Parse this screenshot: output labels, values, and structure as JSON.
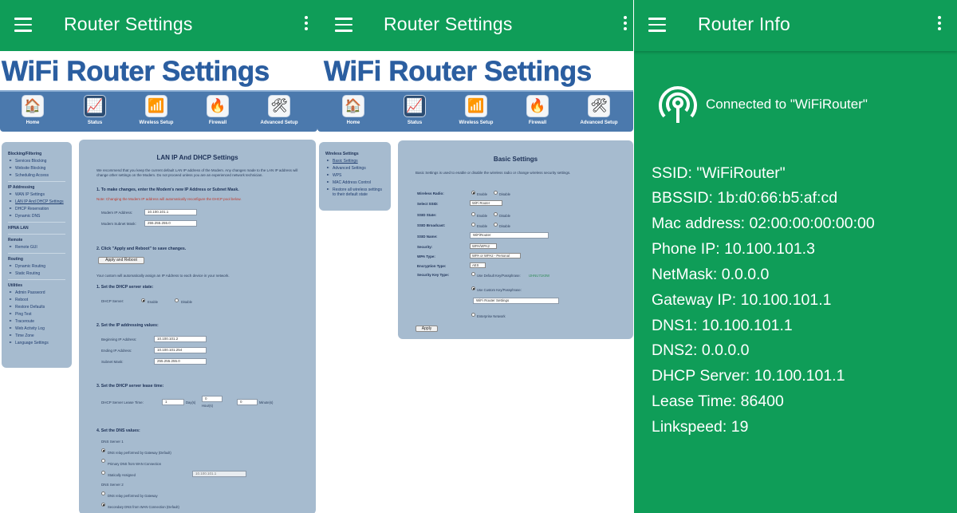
{
  "screen1": {
    "appbar_title": "Router Settings",
    "page_heading": "WiFi Router Settings",
    "nav": [
      {
        "label": "Home",
        "icon": "home-icon"
      },
      {
        "label": "Status",
        "icon": "status-icon"
      },
      {
        "label": "Wireless Setup",
        "icon": "wifi-icon"
      },
      {
        "label": "Firewall",
        "icon": "firewall-icon"
      },
      {
        "label": "Advanced Setup",
        "icon": "tools-icon"
      }
    ],
    "sidebar": {
      "blocking_title": "Blocking/Filtering",
      "blocking": [
        "Services Blocking",
        "Website Blocking",
        "Scheduling Access"
      ],
      "ip_title": "IP Addressing",
      "ip": [
        "WAN IP Settings",
        "LAN IP And DHCP Settings",
        "DHCP Reservation",
        "Dynamic DNS"
      ],
      "hpna_title": "HPNA LAN",
      "remote_title": "Remote",
      "remote": [
        "Remote GUI"
      ],
      "routing_title": "Routing",
      "routing": [
        "Dynamic Routing",
        "Static Routing"
      ],
      "util_title": "Utilities",
      "util": [
        "Admin Password",
        "Reboot",
        "Restore Defaults",
        "Ping Test",
        "Traceroute",
        "Web Activity Log",
        "Time Zone",
        "Language Settings"
      ]
    },
    "panel": {
      "title": "LAN IP And DHCP Settings",
      "intro": "We recommend that you keep the current default LAN IP address of the Modem. Any changes made to the LAN IP address will change other settings on the Modem. Do not proceed unless you are an experienced network technician.",
      "step1": "1. To make changes, enter the Modem's new IP Address or Subnet Mask.",
      "warning": "Note: Changing the Modem IP address will automatically reconfigure the DHCP pool below.",
      "modem_ip_label": "Modem IP Address:",
      "modem_ip": "10.100.101.1",
      "subnet_label": "Modem Subnet Mask:",
      "subnet": "255.255.255.0",
      "step2": "2. Click \"Apply and Reboot\" to save changes.",
      "apply_reboot": "Apply and Reboot",
      "auto_text": "Your custom will automatically assign an IP Address to each device in your network.",
      "dhcp1": "1. Set the DHCP server state:",
      "dhcp_server_label": "DHCP Server:",
      "enable": "Enable",
      "disable": "Disable",
      "dhcp2": "2. Set the IP addressing values:",
      "begin_label": "Beginning IP Address:",
      "begin": "10.100.101.2",
      "end_label": "Ending IP Address:",
      "end": "10.100.101.254",
      "mask_label": "Subnet Mask:",
      "mask": "255.255.255.0",
      "dhcp3": "3. Set the DHCP server lease time:",
      "lease_label": "DHCP Server Lease Time:",
      "lease_days": "1",
      "days": "Day(s)",
      "lease_hours": "0",
      "hours": "Hour(s)",
      "lease_min": "0",
      "minutes": "Minute(s)",
      "dhcp4": "4. Set the DNS values:",
      "dns1_title": "DNS Server 1",
      "dns1_opts": [
        "DNS relay performed by Gateway (Default)",
        "Primary DNS from WAN Connection",
        "Statically Assigned"
      ],
      "static_dns": "10.100.101.1",
      "dns2_title": "DNS Server 2",
      "dns2_opts": [
        "DNS relay performed by Gateway",
        "Secondary DNS from WAN Connection (Default)"
      ]
    }
  },
  "screen2": {
    "appbar_title": "Router Settings",
    "page_heading": "WiFi Router Settings",
    "nav": [
      {
        "label": "Home",
        "icon": "home-icon"
      },
      {
        "label": "Status",
        "icon": "status-icon"
      },
      {
        "label": "Wireless Setup",
        "icon": "wifi-icon"
      },
      {
        "label": "Firewall",
        "icon": "firewall-icon"
      },
      {
        "label": "Advanced Setup",
        "icon": "tools-icon"
      }
    ],
    "sidebar": {
      "title": "Wireless Settings",
      "items": [
        "Basic Settings",
        "Advanced Settings",
        "WPS",
        "MAC Address Control",
        "Restore all wireless settings to their default state"
      ]
    },
    "panel": {
      "title": "Basic Settings",
      "intro": "Basic Settings is used to enable or disable the wireless radio or change wireless security settings.",
      "radio_label": "Wireless Radio:",
      "enable": "Enable",
      "disable": "Disable",
      "ssid_select_label": "Select SSID:",
      "ssid_select": "WiFi Router",
      "ssid_state_label": "SSID State:",
      "ssid_bcast_label": "SSID Broadcast:",
      "ssid_name_label": "SSID Name:",
      "ssid_name": "WiFiRouter",
      "security_label": "Security:",
      "security": "WPA/WPA2",
      "wpa_label": "WPA Type:",
      "wpa": "WPA or WPA2 - Personal",
      "enc_label": "Encryption Type:",
      "enc": "AES",
      "key_label": "Security Key Type:",
      "key_default": "Use Default Key/Passphrase:",
      "key_default_val": "IJHNU71K0W",
      "key_custom": "Use Custom Key/Passphrase:",
      "key_custom_val": "WiFi Router Settings",
      "enterprise": "Enterprise Network",
      "apply": "Apply"
    }
  },
  "screen3": {
    "appbar_title": "Router Info",
    "connected": "Connected to \"WiFiRouter\"",
    "lines": [
      "SSID: \"WiFiRouter\"",
      "BBSSID:  1b:d0:66:b5:af:cd",
      "Mac address: 02:00:00:00:00:00",
      "Phone IP: 10.100.101.3",
      "NetMask: 0.0.0.0",
      "Gateway IP: 10.100.101.1",
      "DNS1: 10.100.101.1",
      "DNS2: 0.0.0.0",
      "DHCP Server: 10.100.101.1",
      "Lease Time: 86400",
      "Linkspeed: 19"
    ]
  },
  "colors": {
    "appbar": "#0f9d58",
    "nav": "#4b79ad",
    "heading": "#2b5ea0",
    "panel": "#a6bbcf"
  }
}
